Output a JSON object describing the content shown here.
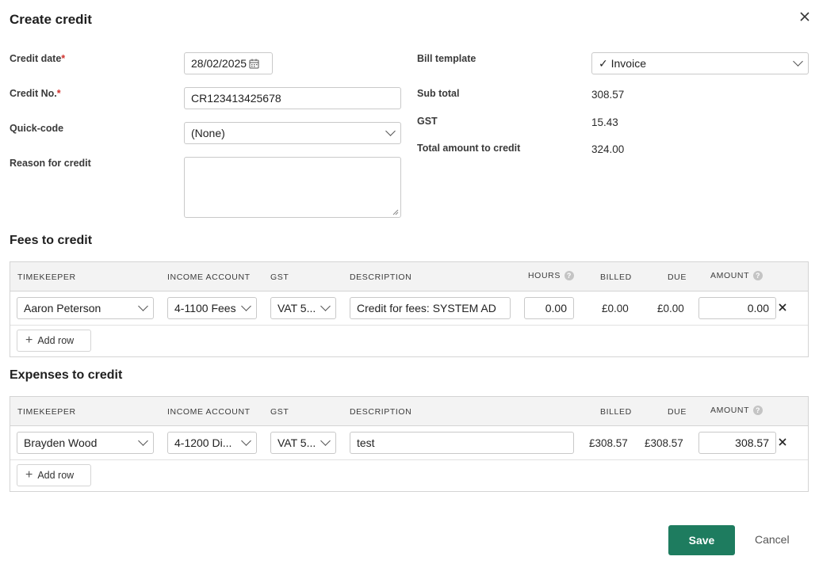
{
  "dialog": {
    "title": "Create credit"
  },
  "form": {
    "credit_date": {
      "label": "Credit date",
      "required_mark": "*",
      "value": "28/02/2025"
    },
    "credit_no": {
      "label": "Credit No.",
      "required_mark": "*",
      "value": "CR123413425678"
    },
    "quick_code": {
      "label": "Quick-code",
      "value": "(None)"
    },
    "reason": {
      "label": "Reason for credit",
      "value": ""
    },
    "bill_template": {
      "label": "Bill template",
      "value": "✓ Invoice"
    },
    "sub_total": {
      "label": "Sub total",
      "value": "308.57"
    },
    "gst": {
      "label": "GST",
      "value": "15.43"
    },
    "total": {
      "label": "Total amount to credit",
      "value": "324.00"
    }
  },
  "fees": {
    "title": "Fees to credit",
    "headers": {
      "timekeeper": "TIMEKEEPER",
      "income_account": "INCOME ACCOUNT",
      "gst": "GST",
      "description": "DESCRIPTION",
      "hours": "HOURS",
      "billed": "BILLED",
      "due": "DUE",
      "amount": "AMOUNT"
    },
    "rows": [
      {
        "timekeeper": "Aaron Peterson",
        "income_account": "4-1100 Fees",
        "gst": "VAT 5...",
        "description": "Credit for fees:  SYSTEM AD",
        "hours": "0.00",
        "billed": "£0.00",
        "due": "£0.00",
        "amount": "0.00"
      }
    ],
    "add_row": "Add row"
  },
  "expenses": {
    "title": "Expenses to credit",
    "headers": {
      "timekeeper": "TIMEKEEPER",
      "income_account": "INCOME ACCOUNT",
      "gst": "GST",
      "description": "DESCRIPTION",
      "billed": "BILLED",
      "due": "DUE",
      "amount": "AMOUNT"
    },
    "rows": [
      {
        "timekeeper": "Brayden Wood",
        "income_account": "4-1200 Di...",
        "gst": "VAT 5...",
        "description": "test",
        "billed": "£308.57",
        "due": "£308.57",
        "amount": "308.57"
      }
    ],
    "add_row": "Add row"
  },
  "actions": {
    "save": "Save",
    "cancel": "Cancel"
  },
  "icons": {
    "close": "close-icon",
    "calendar": "calendar-icon",
    "help": "help-icon",
    "remove": "remove-row-icon",
    "plus": "plus-icon",
    "chevron": "chevron-down-icon"
  },
  "colors": {
    "primary": "#1e7c5f",
    "required": "#d0312d",
    "header_bg": "#f3f3f3"
  }
}
